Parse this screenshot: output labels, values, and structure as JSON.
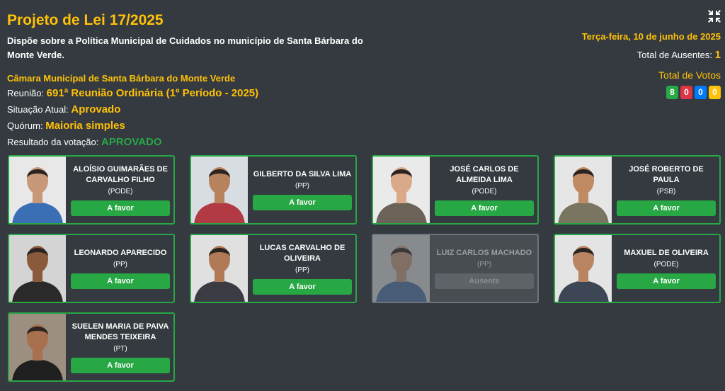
{
  "header": {
    "title": "Projeto de Lei 17/2025",
    "ementa": "Dispõe sobre a Política Municipal de Cuidados no município de Santa Bárbara do Monte Verde.",
    "camara": "Câmara Municipal de Santa Bárbara do Monte Verde",
    "reuniao_label": "Reunião:",
    "reuniao_value": "691ª Reunião Ordinária (1º Período - 2025)",
    "situacao_label": "Situação Atual:",
    "situacao_value": "Aprovado",
    "quorum_label": "Quórum:",
    "quorum_value": "Maioria simples",
    "resultado_label": "Resultado da votação:",
    "resultado_value": "APROVADO"
  },
  "right_panel": {
    "fullscreen_icon": "compress-icon",
    "date": "Terça-feira, 10 de junho de 2025",
    "absent_label": "Total de Ausentes:",
    "absent_count": "1",
    "votes_title": "Total de Votos",
    "vote_counts": [
      {
        "value": "8",
        "color": "#28a745"
      },
      {
        "value": "0",
        "color": "#dc3545"
      },
      {
        "value": "0",
        "color": "#007bff"
      },
      {
        "value": "0",
        "color": "#ffc107"
      }
    ]
  },
  "colors": {
    "background": "#343a40",
    "accent": "#ffc107",
    "success": "#28a745"
  },
  "councilors": [
    {
      "name": "ALOÍSIO GUIMARÃES DE CARVALHO FILHO",
      "party": "(PODE)",
      "vote": "A favor",
      "status": "voted"
    },
    {
      "name": "GILBERTO DA SILVA LIMA",
      "party": "(PP)",
      "vote": "A favor",
      "status": "voted"
    },
    {
      "name": "JOSÉ CARLOS DE ALMEIDA LIMA",
      "party": "(PODE)",
      "vote": "A favor",
      "status": "voted"
    },
    {
      "name": "JOSÉ ROBERTO DE PAULA",
      "party": "(PSB)",
      "vote": "A favor",
      "status": "voted"
    },
    {
      "name": "LEONARDO APARECIDO",
      "party": "(PP)",
      "vote": "A favor",
      "status": "voted"
    },
    {
      "name": "LUCAS CARVALHO DE OLIVEIRA",
      "party": "(PP)",
      "vote": "A favor",
      "status": "voted"
    },
    {
      "name": "LUIZ CARLOS MACHADO",
      "party": "(PP)",
      "vote": "Ausente",
      "status": "absent"
    },
    {
      "name": "MAXUEL DE OLIVEIRA",
      "party": "(PODE)",
      "vote": "A favor",
      "status": "voted"
    },
    {
      "name": "SUELEN MARIA DE PAIVA MENDES TEIXEIRA",
      "party": "(PT)",
      "vote": "A favor",
      "status": "voted"
    }
  ]
}
